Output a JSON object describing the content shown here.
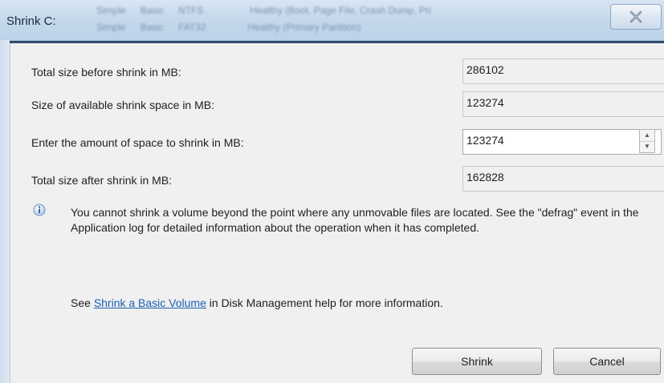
{
  "window": {
    "title": "Shrink C:",
    "close_icon": "close-icon"
  },
  "fields": [
    {
      "label": "Total size before shrink in MB:",
      "value": "286102",
      "editable": false
    },
    {
      "label": "Size of available shrink space in MB:",
      "value": "123274",
      "editable": false
    },
    {
      "label": "Enter the amount of space to shrink in MB:",
      "value": "123274",
      "editable": true
    },
    {
      "label": "Total size after shrink in MB:",
      "value": "162828",
      "editable": false
    }
  ],
  "info": {
    "icon": "info-icon",
    "text": "You cannot shrink a volume beyond the point where any unmovable files are located. See the \"defrag\" event in the Application log for detailed information about the operation when it has completed."
  },
  "help": {
    "prefix": "See ",
    "link": "Shrink a Basic Volume",
    "suffix": " in Disk Management help for more information."
  },
  "buttons": {
    "shrink": "Shrink",
    "cancel": "Cancel"
  }
}
